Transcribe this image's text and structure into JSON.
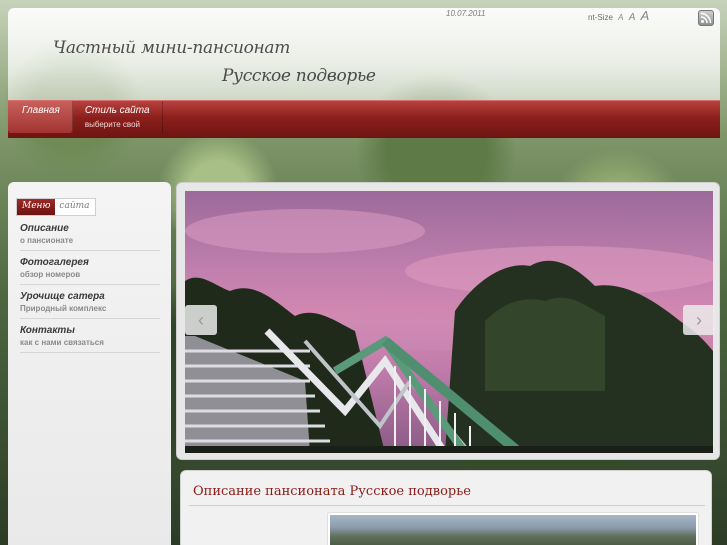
{
  "header": {
    "date": "10.07.2011",
    "font_size_label": "nt-Size",
    "font_size_options": [
      "A",
      "A",
      "A"
    ],
    "subtitle": "Частный мини-пансионат",
    "title": "Русское подворье",
    "rss_icon": "rss-icon"
  },
  "nav": {
    "items": [
      {
        "label": "Главная",
        "sub": ""
      },
      {
        "label": "Стиль сайта",
        "sub": "выберите свой"
      }
    ]
  },
  "sidebar": {
    "menu_head_a": "Меню",
    "menu_head_b": "сайта",
    "items": [
      {
        "title": "Описание",
        "desc": "о пансионате"
      },
      {
        "title": "Фотогалерея",
        "desc": "обзор номеров"
      },
      {
        "title": "Урочище сатера",
        "desc": "Природный комплекс"
      },
      {
        "title": "Контакты",
        "desc": "как с нами связаться"
      }
    ]
  },
  "slider": {
    "prev_icon": "chevron-left-icon",
    "next_icon": "chevron-right-icon",
    "prev_glyph": "‹",
    "next_glyph": "›"
  },
  "content": {
    "title": "Описание пансионата Русское подворье"
  },
  "colors": {
    "accent": "#8b1a17",
    "nav": "#8c1f1c"
  }
}
